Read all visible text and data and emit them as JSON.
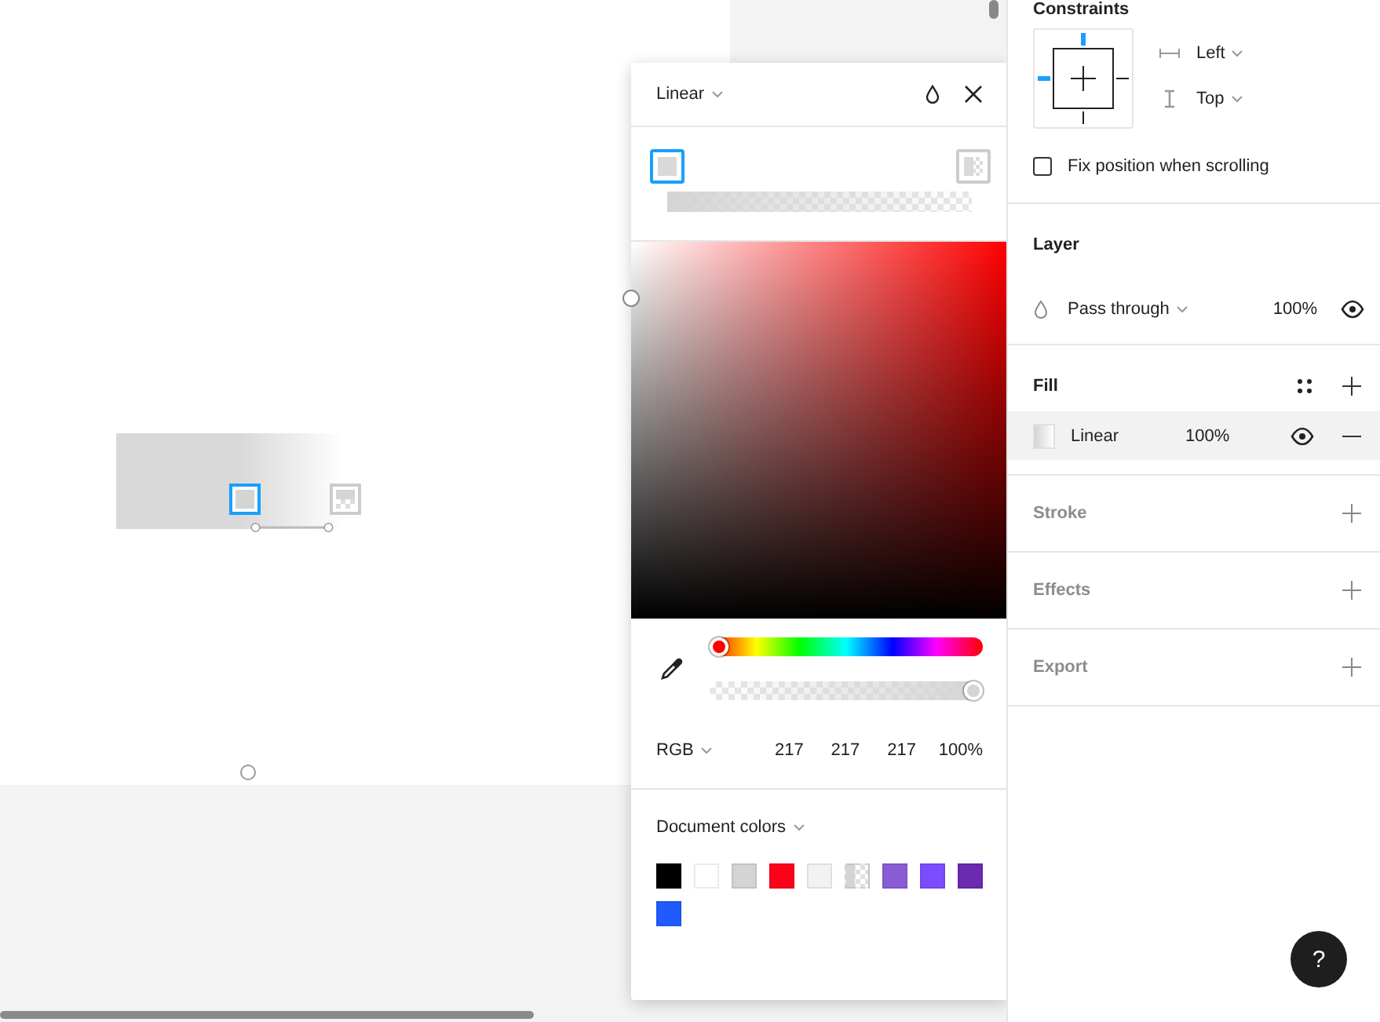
{
  "canvas": {
    "gradient_stops": [
      {
        "selected": true
      },
      {
        "selected": false
      }
    ]
  },
  "color_picker": {
    "fill_type": "Linear",
    "stops": [
      {
        "selected": true,
        "color": "#d9d9d9"
      },
      {
        "selected": false,
        "color": "#d9d9d9"
      }
    ],
    "hue": {
      "level": 0
    },
    "opacity": {
      "level": 1
    },
    "color_model": "RGB",
    "values": [
      "217",
      "217",
      "217",
      "100%"
    ],
    "document_colors": {
      "label": "Document colors",
      "swatches": [
        {
          "kind": "solid",
          "color": "#000000"
        },
        {
          "kind": "solid",
          "color": "#ffffff"
        },
        {
          "kind": "solid",
          "color": "#d4d4d4"
        },
        {
          "kind": "solid",
          "color": "#ff0019"
        },
        {
          "kind": "solid",
          "color": "#f2f2f2"
        },
        {
          "kind": "fade",
          "color": "#d4d4d4"
        },
        {
          "kind": "solid",
          "color": "#8a5cd6"
        },
        {
          "kind": "solid",
          "color": "#7b4dff"
        },
        {
          "kind": "solid",
          "color": "#6b2bb0"
        },
        {
          "kind": "solid",
          "color": "#1f5cff"
        }
      ]
    }
  },
  "panel": {
    "constraints": {
      "title": "Constraints",
      "horizontal": "Left",
      "vertical": "Top",
      "fix_position": {
        "label": "Fix position when scrolling",
        "checked": false
      }
    },
    "layer": {
      "title": "Layer",
      "blend": "Pass through",
      "opacity": "100%",
      "visible": true
    },
    "fill": {
      "title": "Fill",
      "items": [
        {
          "type": "Linear",
          "opacity": "100%",
          "visible": true
        }
      ]
    },
    "sections": [
      {
        "title": "Stroke"
      },
      {
        "title": "Effects"
      },
      {
        "title": "Export"
      }
    ]
  },
  "help": {
    "label": "?"
  }
}
